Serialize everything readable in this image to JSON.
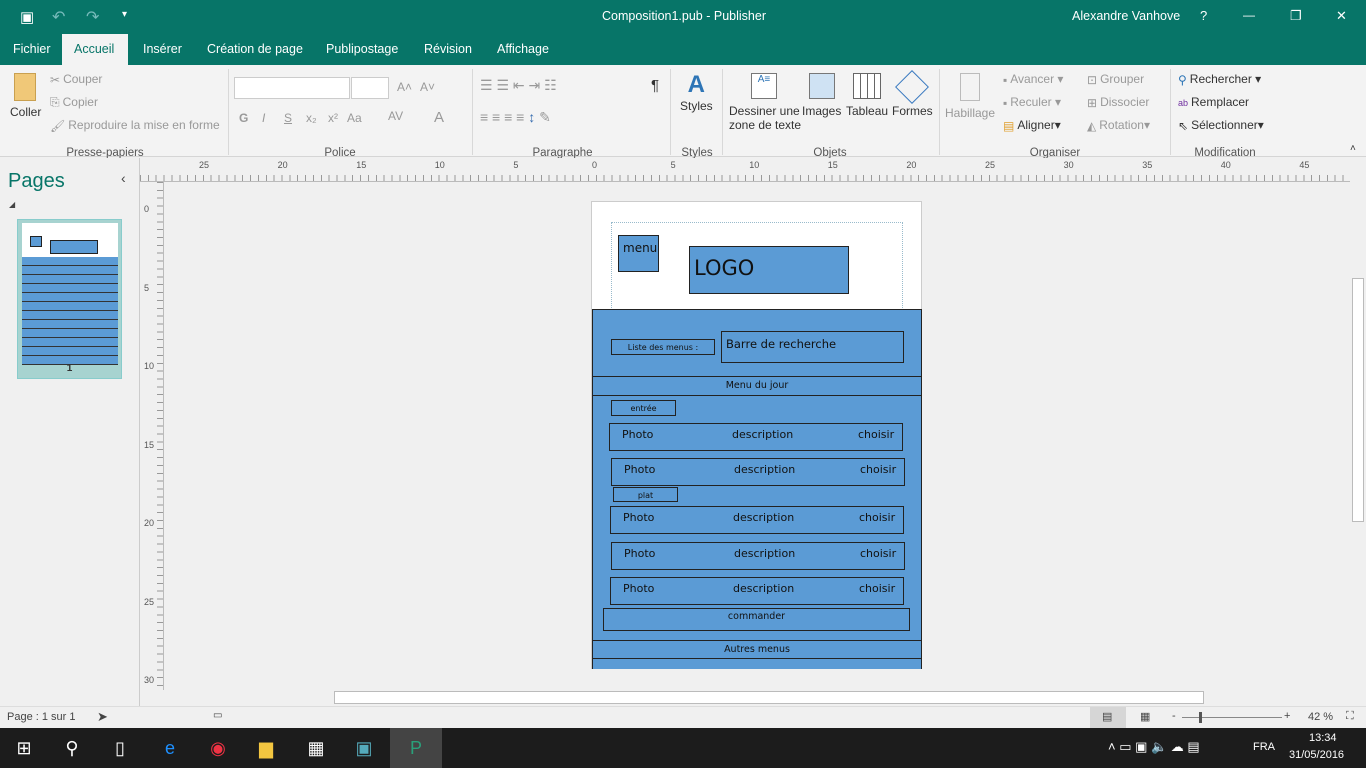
{
  "window": {
    "title": "Composition1.pub - Publisher",
    "user": "Alexandre Vanhove",
    "help": "?",
    "minimize": "—",
    "restore": "❐",
    "close": "✕"
  },
  "qat": {
    "save_icon": "save-icon",
    "undo": "↶",
    "redo": "↷",
    "customize": "▾"
  },
  "tabs": [
    "Fichier",
    "Accueil",
    "Insérer",
    "Création de page",
    "Publipostage",
    "Révision",
    "Affichage"
  ],
  "ribbon": {
    "clipboard": {
      "paste": "Coller",
      "cut": "Couper",
      "copy": "Copier",
      "format_painter": "Reproduire la mise en forme",
      "group": "Presse-papiers"
    },
    "font": {
      "font_name": "",
      "font_size": "",
      "grow": "A˄",
      "shrink": "A˅",
      "bold": "G",
      "italic": "I",
      "underline": "S",
      "subscript": "x₂",
      "superscript": "x²",
      "case": "Aa",
      "spacing": "AV",
      "color": "A",
      "group": "Police"
    },
    "paragraph": {
      "pilcrow": "¶",
      "group": "Paragraphe"
    },
    "styles": {
      "label": "Styles",
      "group": "Styles"
    },
    "objects": {
      "textbox_l1": "Dessiner une",
      "textbox_l2": "zone de texte",
      "images": "Images",
      "table": "Tableau",
      "shapes": "Formes",
      "group": "Objets"
    },
    "arrange": {
      "wrap": "Habillage",
      "forward": "Avancer",
      "backward": "Reculer",
      "align": "Aligner",
      "group_btn": "Grouper",
      "ungroup": "Dissocier",
      "rotate": "Rotation",
      "group": "Organiser"
    },
    "editing": {
      "find": "Rechercher",
      "replace": "Remplacer",
      "select": "Sélectionner",
      "group": "Modification"
    }
  },
  "pages_pane": {
    "title": "Pages",
    "collapse": "‹",
    "thumb_number": "1"
  },
  "ruler": {
    "h": [
      "25",
      "20",
      "15",
      "10",
      "5",
      "0",
      "5",
      "10",
      "15",
      "20",
      "25",
      "30",
      "35",
      "40",
      "45"
    ],
    "v": [
      "0",
      "5",
      "10",
      "15",
      "20",
      "25",
      "30"
    ]
  },
  "document": {
    "menu": "menu",
    "logo": "LOGO",
    "menu_list": "Liste des menus :",
    "search": "Barre de recherche",
    "menu_of_day": "Menu du jour",
    "entree": "entrée",
    "plat": "plat",
    "rows": [
      {
        "photo": "Photo",
        "desc": "description",
        "choose": "choisir"
      },
      {
        "photo": "Photo",
        "desc": "description",
        "choose": "choisir"
      },
      {
        "photo": "Photo",
        "desc": "description",
        "choose": "choisir"
      },
      {
        "photo": "Photo",
        "desc": "description",
        "choose": "choisir"
      },
      {
        "photo": "Photo",
        "desc": "description",
        "choose": "choisir"
      }
    ],
    "order": "commander",
    "other_menus": "Autres menus",
    "fill_color": "#5b9bd5"
  },
  "status": {
    "page": "Page : 1 sur 1",
    "zoom": "42 %",
    "zoom_percent": 42,
    "minus": "-",
    "plus": "+"
  },
  "taskbar": {
    "lang": "FRA",
    "time": "13:34",
    "date": "31/05/2016"
  }
}
